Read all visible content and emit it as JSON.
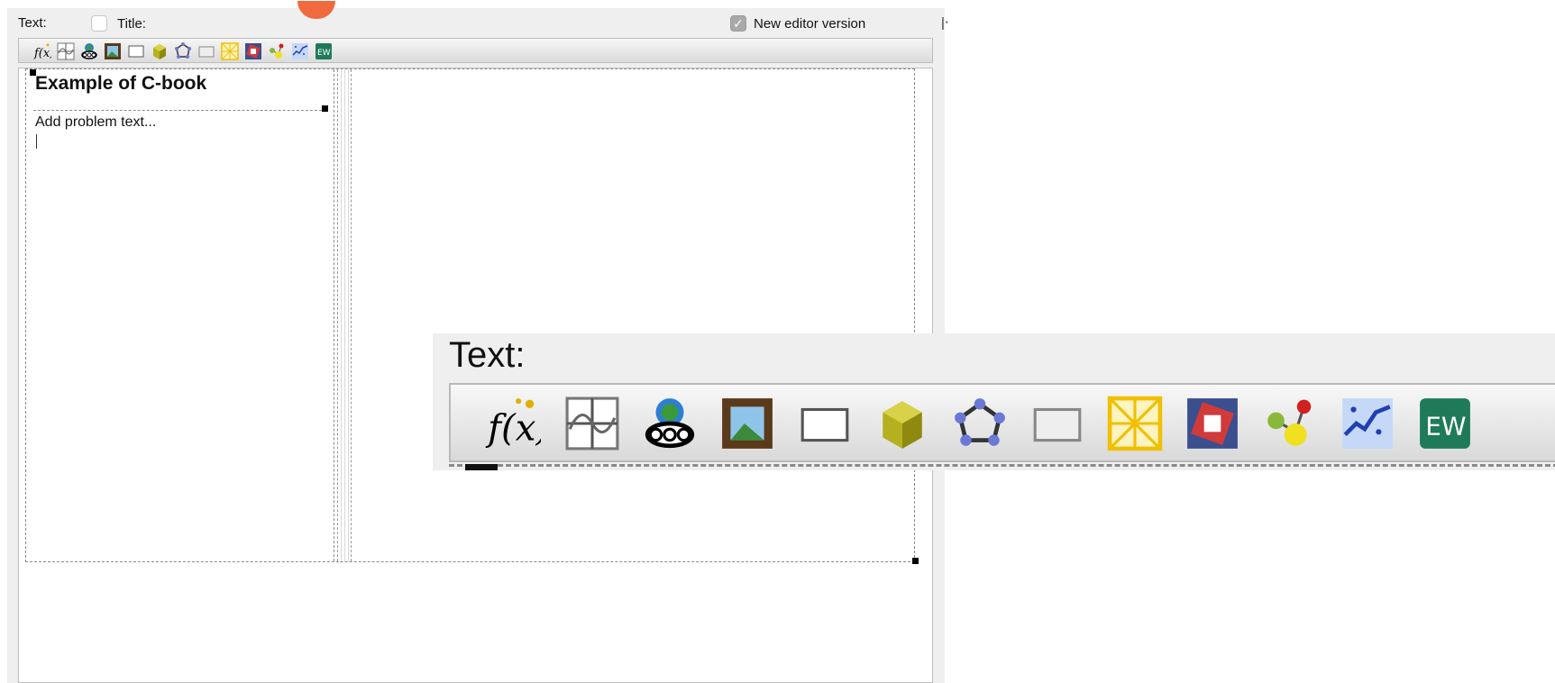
{
  "panel": {
    "text_label": "Text:",
    "title_label": "Title:",
    "new_editor_label": "New editor version",
    "new_editor_checked": true
  },
  "toolbar": {
    "icons": [
      "function-icon",
      "graph-icon",
      "geogebra-icon",
      "image-icon",
      "text-box-icon",
      "3d-cube-icon",
      "polygon-icon",
      "empty-box-icon",
      "grid-icon",
      "rotated-squares-icon",
      "nodes-icon",
      "scatter-icon",
      "ew-icon"
    ]
  },
  "editor": {
    "title": "Example of C-book",
    "placeholder": "Add problem text..."
  },
  "zoom": {
    "text_label": "Text:"
  },
  "colors": {
    "accent_arc": "#f06a3d",
    "panel_bg": "#efefef"
  }
}
